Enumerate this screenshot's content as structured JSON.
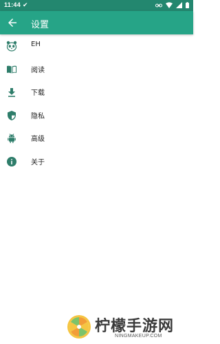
{
  "statusbar": {
    "time": "11:44"
  },
  "appbar": {
    "title": "设置",
    "back_icon": "arrow-left-icon"
  },
  "colors": {
    "primary": "#26a487",
    "primary_dark": "#23876f",
    "icon": "#2e7d6a"
  },
  "settings": [
    {
      "label": "EH",
      "icon": "panda-icon"
    },
    {
      "label": "阅读",
      "icon": "book-icon"
    },
    {
      "label": "下载",
      "icon": "download-icon"
    },
    {
      "label": "隐私",
      "icon": "shield-icon"
    },
    {
      "label": "高级",
      "icon": "android-icon"
    },
    {
      "label": "关于",
      "icon": "info-icon"
    }
  ],
  "watermark": {
    "name": "柠檬手游网",
    "domain": "NINGMAKEUP.COM"
  }
}
